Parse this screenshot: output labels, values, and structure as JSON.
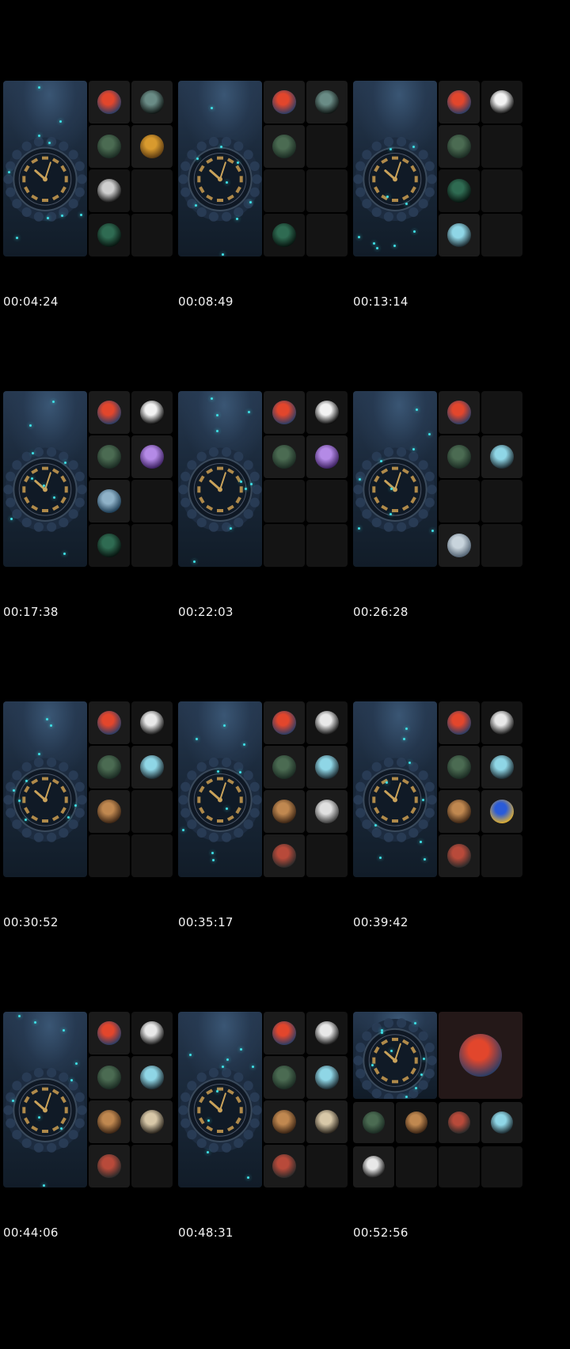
{
  "sheet": {
    "timestamps": [
      "00:04:24",
      "00:08:49",
      "00:13:14",
      "00:17:38",
      "00:22:03",
      "00:26:28",
      "00:30:52",
      "00:35:17",
      "00:39:42",
      "00:44:06",
      "00:48:31",
      "00:52:56"
    ]
  },
  "frames": [
    {
      "layout": "std",
      "cells": [
        {
          "avatar": "red-silhouette-avatar",
          "hi": true
        },
        {
          "avatar": "hooded-figure-avatar",
          "hi": true
        },
        {
          "avatar": "green-lit-man-avatar",
          "hi": true
        },
        {
          "avatar": "gold-figure-avatar",
          "hi": true
        },
        {
          "avatar": "dark-hood-avatar",
          "hi": false
        },
        {
          "avatar": "",
          "hi": false
        },
        {
          "avatar": "green-hood-avatar",
          "hi": false
        },
        {
          "avatar": "",
          "hi": false
        }
      ]
    },
    {
      "layout": "std",
      "cells": [
        {
          "avatar": "red-silhouette-avatar",
          "hi": true
        },
        {
          "avatar": "hooded-figure-avatar",
          "hi": true
        },
        {
          "avatar": "green-lit-man-avatar",
          "hi": true
        },
        {
          "avatar": "",
          "hi": false
        },
        {
          "avatar": "",
          "hi": false
        },
        {
          "avatar": "",
          "hi": false
        },
        {
          "avatar": "green-hood-avatar",
          "hi": false
        },
        {
          "avatar": "",
          "hi": false
        }
      ]
    },
    {
      "layout": "std",
      "cells": [
        {
          "avatar": "red-silhouette-avatar",
          "hi": true
        },
        {
          "avatar": "hat-figure-avatar",
          "hi": false
        },
        {
          "avatar": "green-lit-man-avatar",
          "hi": true
        },
        {
          "avatar": "",
          "hi": false
        },
        {
          "avatar": "green-hood-avatar",
          "hi": false
        },
        {
          "avatar": "",
          "hi": false
        },
        {
          "avatar": "cyan-man-avatar",
          "hi": true
        },
        {
          "avatar": "",
          "hi": false
        }
      ]
    },
    {
      "layout": "std",
      "cells": [
        {
          "avatar": "red-silhouette-avatar",
          "hi": true
        },
        {
          "avatar": "hat-figure-avatar",
          "hi": false
        },
        {
          "avatar": "green-lit-man-avatar",
          "hi": true
        },
        {
          "avatar": "purple-light-avatar",
          "hi": true
        },
        {
          "avatar": "blue-landscape-avatar",
          "hi": true
        },
        {
          "avatar": "",
          "hi": false
        },
        {
          "avatar": "green-hood-avatar",
          "hi": false
        },
        {
          "avatar": "",
          "hi": false
        }
      ]
    },
    {
      "layout": "std",
      "cells": [
        {
          "avatar": "red-silhouette-avatar",
          "hi": true
        },
        {
          "avatar": "hat-figure-avatar",
          "hi": false
        },
        {
          "avatar": "green-lit-man-avatar",
          "hi": true
        },
        {
          "avatar": "purple-light-avatar",
          "hi": true
        },
        {
          "avatar": "",
          "hi": false
        },
        {
          "avatar": "",
          "hi": false
        },
        {
          "avatar": "",
          "hi": false
        },
        {
          "avatar": "",
          "hi": false
        }
      ]
    },
    {
      "layout": "std",
      "cells": [
        {
          "avatar": "red-silhouette-avatar",
          "hi": true
        },
        {
          "avatar": "",
          "hi": false
        },
        {
          "avatar": "green-lit-man-avatar",
          "hi": true
        },
        {
          "avatar": "cyan-man-avatar",
          "hi": true
        },
        {
          "avatar": "",
          "hi": false
        },
        {
          "avatar": "",
          "hi": false
        },
        {
          "avatar": "white-haired-man-avatar",
          "hi": true
        },
        {
          "avatar": "",
          "hi": false
        }
      ]
    },
    {
      "layout": "std",
      "cells": [
        {
          "avatar": "red-silhouette-avatar",
          "hi": true
        },
        {
          "avatar": "bw-man-avatar",
          "hi": false
        },
        {
          "avatar": "green-lit-man-avatar",
          "hi": true
        },
        {
          "avatar": "cyan-man-avatar",
          "hi": true
        },
        {
          "avatar": "brown-figure-avatar",
          "hi": true
        },
        {
          "avatar": "",
          "hi": false
        },
        {
          "avatar": "",
          "hi": false
        },
        {
          "avatar": "",
          "hi": false
        }
      ]
    },
    {
      "layout": "std",
      "cells": [
        {
          "avatar": "red-silhouette-avatar",
          "hi": true
        },
        {
          "avatar": "bw-man-avatar",
          "hi": false
        },
        {
          "avatar": "green-lit-man-avatar",
          "hi": true
        },
        {
          "avatar": "cyan-man-avatar",
          "hi": true
        },
        {
          "avatar": "brown-figure-avatar",
          "hi": true
        },
        {
          "avatar": "2025-badge-avatar",
          "hi": true
        },
        {
          "avatar": "dark-warrior-avatar",
          "hi": true
        },
        {
          "avatar": "",
          "hi": false
        }
      ]
    },
    {
      "layout": "std",
      "cells": [
        {
          "avatar": "red-silhouette-avatar",
          "hi": true
        },
        {
          "avatar": "bw-man-avatar",
          "hi": false
        },
        {
          "avatar": "green-lit-man-avatar",
          "hi": true
        },
        {
          "avatar": "cyan-man-avatar",
          "hi": true
        },
        {
          "avatar": "brown-figure-avatar",
          "hi": true
        },
        {
          "avatar": "blue-suit-avatar",
          "hi": true
        },
        {
          "avatar": "dark-warrior-avatar",
          "hi": true
        },
        {
          "avatar": "",
          "hi": false
        }
      ]
    },
    {
      "layout": "std",
      "cells": [
        {
          "avatar": "red-silhouette-avatar",
          "hi": true
        },
        {
          "avatar": "bw-man-avatar",
          "hi": false
        },
        {
          "avatar": "green-lit-man-avatar",
          "hi": true
        },
        {
          "avatar": "cyan-man-avatar",
          "hi": true
        },
        {
          "avatar": "brown-figure-avatar",
          "hi": true
        },
        {
          "avatar": "horned-figure-avatar",
          "hi": true
        },
        {
          "avatar": "dark-warrior-avatar",
          "hi": true
        },
        {
          "avatar": "",
          "hi": false
        }
      ]
    },
    {
      "layout": "std",
      "cells": [
        {
          "avatar": "red-silhouette-avatar",
          "hi": true
        },
        {
          "avatar": "bw-man-avatar",
          "hi": false
        },
        {
          "avatar": "green-lit-man-avatar",
          "hi": true
        },
        {
          "avatar": "cyan-man-avatar",
          "hi": true
        },
        {
          "avatar": "brown-figure-avatar",
          "hi": true
        },
        {
          "avatar": "horned-figure-avatar",
          "hi": true
        },
        {
          "avatar": "dark-warrior-avatar",
          "hi": true
        },
        {
          "avatar": "",
          "hi": false
        }
      ]
    },
    {
      "layout": "alt",
      "cells": [
        {
          "avatar": "green-lit-man-avatar",
          "hi": true
        },
        {
          "avatar": "brown-figure-avatar",
          "hi": false
        },
        {
          "avatar": "dark-warrior-avatar",
          "hi": true
        },
        {
          "avatar": "cyan-man-avatar",
          "hi": true
        },
        {
          "avatar": "bw-man-avatar",
          "hi": true
        },
        {
          "avatar": "",
          "hi": false
        },
        {
          "avatar": "",
          "hi": false
        },
        {
          "avatar": "",
          "hi": false
        }
      ],
      "speaker": "red-silhouette-avatar"
    }
  ],
  "avatar_colors": {
    "red-silhouette-avatar": [
      "#e2462c",
      "#2a3d66"
    ],
    "hooded-figure-avatar": [
      "#6a8c86",
      "#0e1412"
    ],
    "hat-figure-avatar": [
      "#f2f2f2",
      "#0a0a0a"
    ],
    "green-lit-man-avatar": [
      "#4b6b52",
      "#1a2a22"
    ],
    "gold-figure-avatar": [
      "#d89a2e",
      "#5a3a12"
    ],
    "dark-hood-avatar": [
      "#cfcfcf",
      "#101010"
    ],
    "green-hood-avatar": [
      "#2f6b52",
      "#07140f"
    ],
    "cyan-man-avatar": [
      "#8fd6e6",
      "#1c2a30"
    ],
    "purple-light-avatar": [
      "#b48ae6",
      "#3a1f5e"
    ],
    "blue-landscape-avatar": [
      "#8fb2c8",
      "#1b3a52"
    ],
    "white-haired-man-avatar": [
      "#c8d4dc",
      "#506070"
    ],
    "bw-man-avatar": [
      "#e8e8e8",
      "#141414"
    ],
    "brown-figure-avatar": [
      "#c08850",
      "#3a2414"
    ],
    "2025-badge-avatar": [
      "#e0e0e0",
      "#3a3a3a"
    ],
    "dark-warrior-avatar": [
      "#b84a3a",
      "#2a2a2a"
    ],
    "blue-suit-avatar": [
      "#2a5bd8",
      "#e0b030"
    ],
    "horned-figure-avatar": [
      "#d8c8a8",
      "#2a241c"
    ]
  },
  "colors": {
    "background": "#000000",
    "cell": "#141414",
    "cell_hi": "#1b1b1b",
    "accent": "#3fe0e6"
  }
}
